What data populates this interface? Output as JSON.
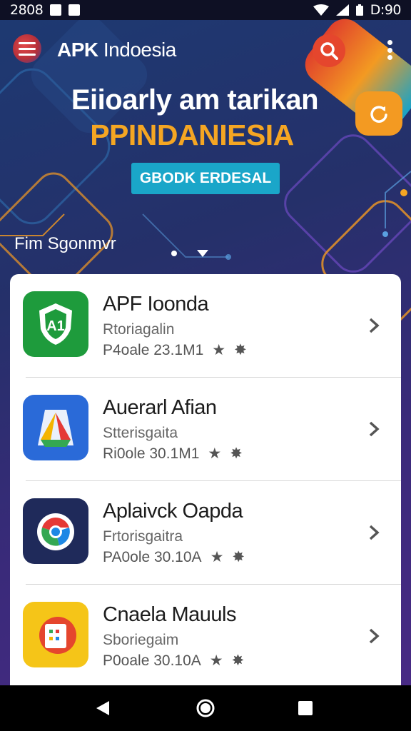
{
  "status_bar": {
    "time": "2808",
    "clock": "D:90"
  },
  "app_bar": {
    "title_bold": "APK",
    "title_rest": " Indoesia"
  },
  "hero": {
    "line1": "Eiioarly am tarikan",
    "line2": "PPINDANIESIA",
    "cta": "GBODK ERDESAL"
  },
  "section": {
    "label": "Fim Sgonmvr"
  },
  "apps": [
    {
      "title": "APF Ioonda",
      "subtitle": "Rtoriagalin",
      "meta": "P4oale  23.1M1",
      "icon": "app-icon-green-shield"
    },
    {
      "title": "Auerarl Afian",
      "subtitle": "Stterisgaita",
      "meta": "Ri0ole  30.1M1",
      "icon": "app-icon-blue-drive"
    },
    {
      "title": "Aplaivck Oapda",
      "subtitle": "Frtorisgaitra",
      "meta": "PA0ole  30.10A",
      "icon": "app-icon-navy-chrome"
    },
    {
      "title": "Cnaela Mauuls",
      "subtitle": "Sboriegaim",
      "meta": "P0oale  30.10A",
      "icon": "app-icon-yellow-slides"
    }
  ],
  "colors": {
    "accent_orange": "#f5a623",
    "cta_blue": "#1aa6c9",
    "search_red": "#e5462d"
  }
}
